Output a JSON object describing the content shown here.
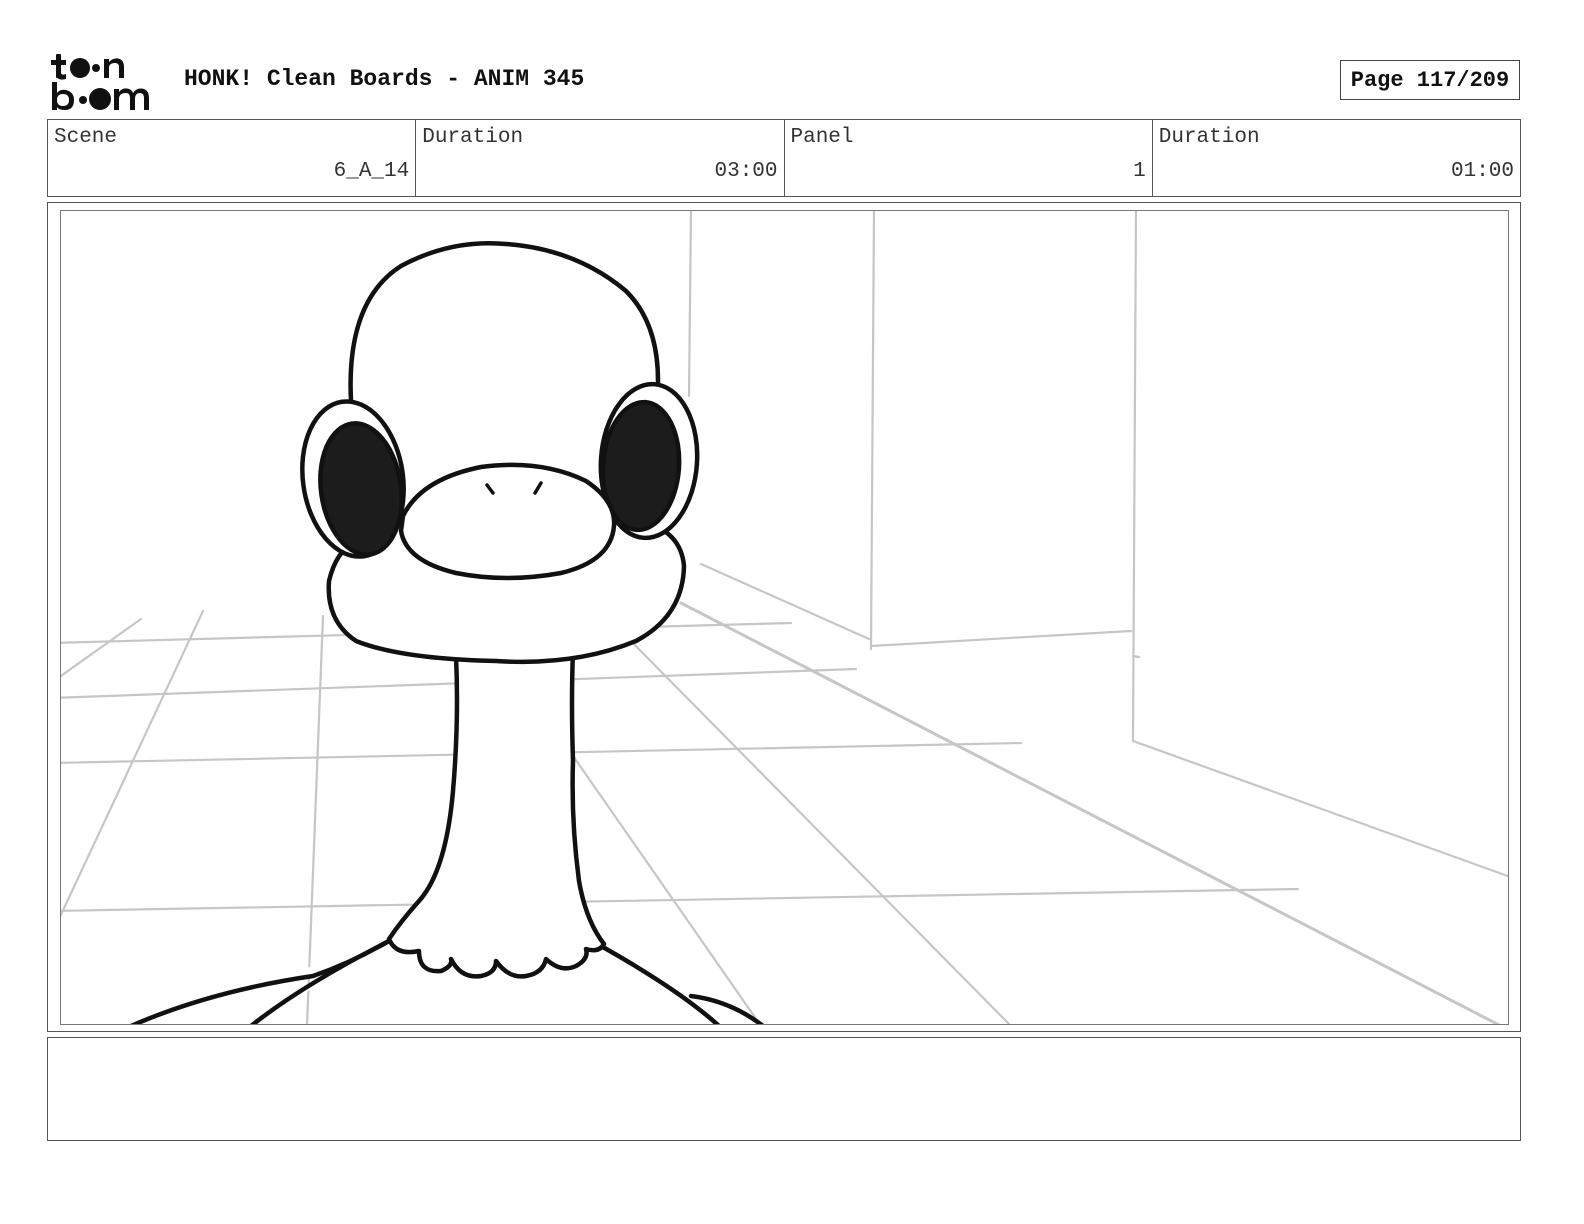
{
  "logo": {
    "name": "toon boom",
    "line1": "toon",
    "line2": "boom"
  },
  "header": {
    "title": "HONK! Clean Boards - ANIM 345",
    "page": "Page 117/209"
  },
  "info": {
    "scene_label": "Scene",
    "scene_value": "6_A_14",
    "scene_duration_label": "Duration",
    "scene_duration_value": "03:00",
    "panel_label": "Panel",
    "panel_value": "1",
    "panel_duration_label": "Duration",
    "panel_duration_value": "01:00"
  },
  "panel": {
    "description": "",
    "colors": {
      "ink": "#111111",
      "guide": "#c4c4c4",
      "eye_fill": "#1c1c1c"
    }
  },
  "notes": {
    "text": ""
  }
}
